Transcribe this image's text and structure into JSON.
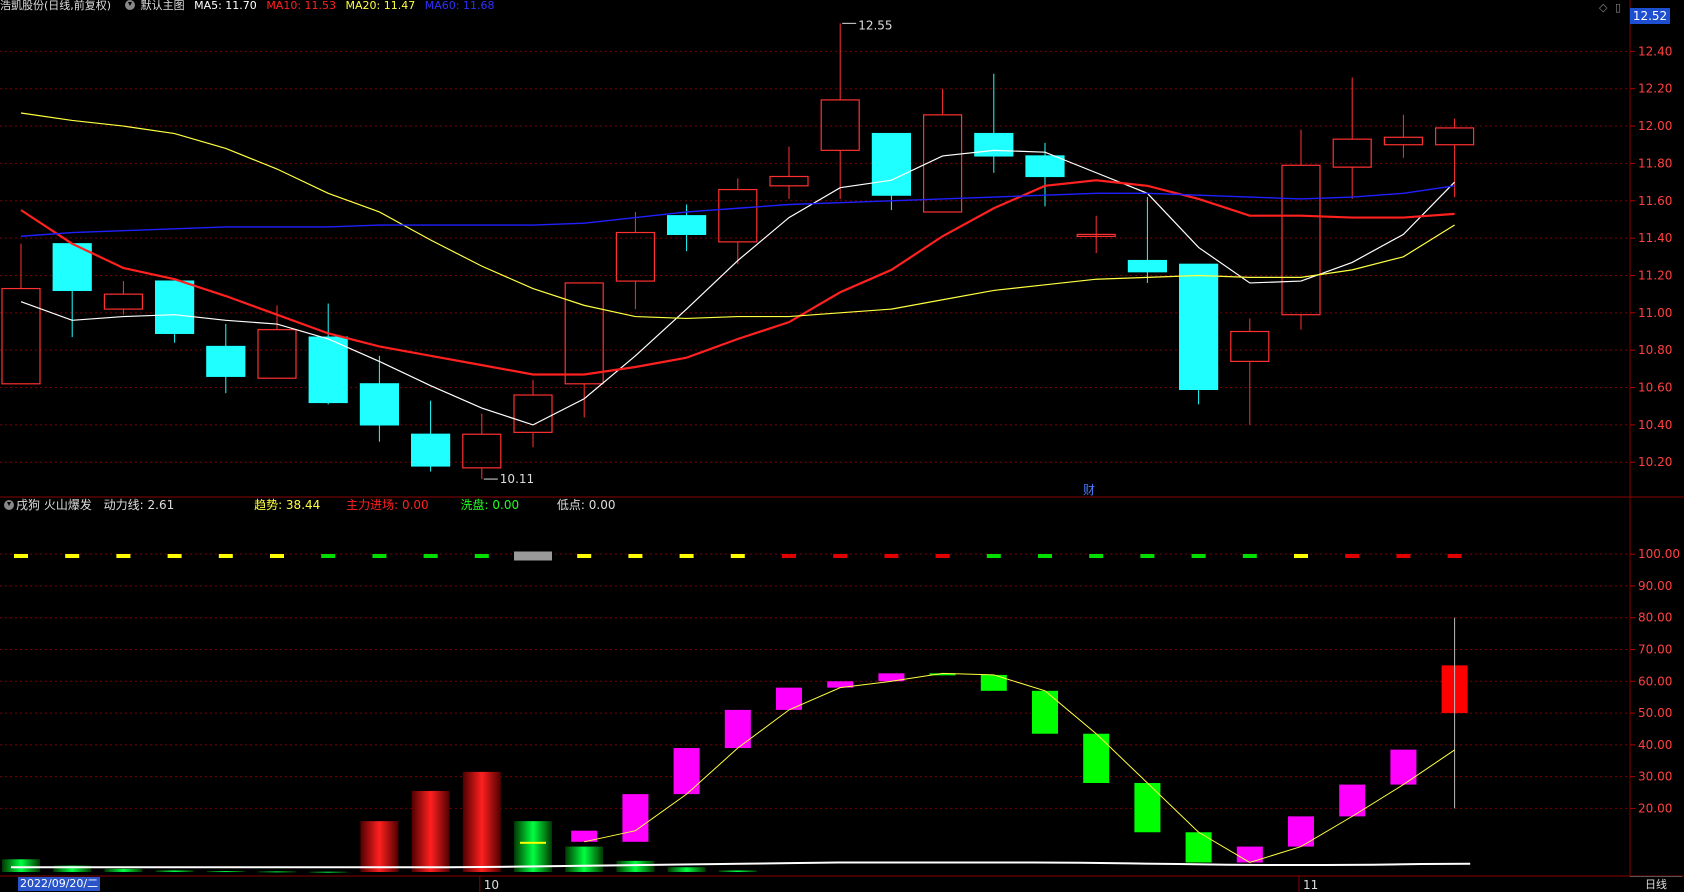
{
  "header": {
    "stock": "浩凱股份",
    "period": "(日线,前复权)",
    "template": "默认主图",
    "ma": [
      {
        "label": "MA5: 11.70",
        "color": "#ffffff"
      },
      {
        "label": "MA10: 11.53",
        "color": "#ff2020"
      },
      {
        "label": "MA20: 11.47",
        "color": "#ffff40"
      },
      {
        "label": "MA60: 11.68",
        "color": "#3030ff"
      }
    ]
  },
  "price_badge": "12.52",
  "indicator_header": {
    "name": "戌狗 火山爆发",
    "fields": [
      {
        "label": "动力线: 2.61",
        "color": "#dddddd"
      },
      {
        "label": "趋势: 38.44",
        "color": "#ffff40"
      },
      {
        "label": "主力进场: 0.00",
        "color": "#ff2020"
      },
      {
        "label": "洗盘: 0.00",
        "color": "#20ff20"
      },
      {
        "label": "低点: 0.00",
        "color": "#dddddd"
      }
    ]
  },
  "cai_label": "财",
  "date_label": "2022/09/20/二",
  "period_tab": "日线",
  "month_labels": [
    "10",
    "11"
  ],
  "colors": {
    "up": "#ff3030",
    "down": "#20ffff",
    "ma5": "#ffffff",
    "ma10": "#ff2020",
    "ma20": "#ffff40",
    "ma60": "#2020ff",
    "grid": "#7a0000",
    "bg": "#000000"
  },
  "chart_data": [
    {
      "type": "candlestick",
      "title": "",
      "y_ticks": [
        10.2,
        10.4,
        10.6,
        10.8,
        11.0,
        11.2,
        11.4,
        11.6,
        11.8,
        12.0,
        12.2,
        12.4
      ],
      "ylim": [
        10.03,
        12.6
      ],
      "annotations": [
        {
          "text": "12.55",
          "index": 16,
          "value": 12.55
        },
        {
          "text": "10.11",
          "index": 9,
          "value": 10.11
        }
      ],
      "candles": [
        {
          "o": 10.62,
          "h": 11.37,
          "l": 10.62,
          "c": 11.13
        },
        {
          "o": 11.37,
          "h": 11.37,
          "l": 10.87,
          "c": 11.12
        },
        {
          "o": 11.02,
          "h": 11.17,
          "l": 10.99,
          "c": 11.1
        },
        {
          "o": 11.17,
          "h": 11.17,
          "l": 10.84,
          "c": 10.89
        },
        {
          "o": 10.82,
          "h": 10.94,
          "l": 10.57,
          "c": 10.66
        },
        {
          "o": 10.65,
          "h": 11.04,
          "l": 10.65,
          "c": 10.91
        },
        {
          "o": 10.87,
          "h": 11.05,
          "l": 10.51,
          "c": 10.52
        },
        {
          "o": 10.62,
          "h": 10.77,
          "l": 10.31,
          "c": 10.4
        },
        {
          "o": 10.35,
          "h": 10.53,
          "l": 10.15,
          "c": 10.18
        },
        {
          "o": 10.17,
          "h": 10.46,
          "l": 10.11,
          "c": 10.35
        },
        {
          "o": 10.36,
          "h": 10.64,
          "l": 10.28,
          "c": 10.56
        },
        {
          "o": 10.62,
          "h": 11.16,
          "l": 10.44,
          "c": 11.16
        },
        {
          "o": 11.17,
          "h": 11.54,
          "l": 11.02,
          "c": 11.43
        },
        {
          "o": 11.52,
          "h": 11.58,
          "l": 11.33,
          "c": 11.42
        },
        {
          "o": 11.38,
          "h": 11.72,
          "l": 11.26,
          "c": 11.66
        },
        {
          "o": 11.68,
          "h": 11.89,
          "l": 11.61,
          "c": 11.73
        },
        {
          "o": 11.87,
          "h": 12.55,
          "l": 11.61,
          "c": 12.14
        },
        {
          "o": 11.96,
          "h": 11.96,
          "l": 11.55,
          "c": 11.63
        },
        {
          "o": 11.54,
          "h": 12.2,
          "l": 11.54,
          "c": 12.06
        },
        {
          "o": 11.96,
          "h": 12.28,
          "l": 11.75,
          "c": 11.84
        },
        {
          "o": 11.84,
          "h": 11.91,
          "l": 11.57,
          "c": 11.73
        },
        {
          "o": 11.42,
          "h": 11.52,
          "l": 11.32,
          "c": 11.42
        },
        {
          "o": 11.28,
          "h": 11.62,
          "l": 11.16,
          "c": 11.22
        },
        {
          "o": 11.26,
          "h": 11.26,
          "l": 10.51,
          "c": 10.59
        },
        {
          "o": 10.74,
          "h": 10.97,
          "l": 10.4,
          "c": 10.9
        },
        {
          "o": 10.99,
          "h": 11.98,
          "l": 10.91,
          "c": 11.79
        },
        {
          "o": 11.78,
          "h": 12.26,
          "l": 11.61,
          "c": 11.93
        },
        {
          "o": 11.9,
          "h": 12.06,
          "l": 11.83,
          "c": 11.94
        },
        {
          "o": 11.9,
          "h": 12.04,
          "l": 11.62,
          "c": 11.99
        }
      ],
      "series": [
        {
          "name": "MA5",
          "values": [
            11.06,
            10.96,
            10.98,
            10.99,
            10.96,
            10.94,
            10.86,
            10.74,
            10.61,
            10.49,
            10.4,
            10.54,
            10.77,
            11.02,
            11.28,
            11.51,
            11.67,
            11.71,
            11.84,
            11.87,
            11.86,
            11.75,
            11.64,
            11.35,
            11.16,
            11.17,
            11.27,
            11.42,
            11.7
          ]
        },
        {
          "name": "MA10",
          "values": [
            11.55,
            11.37,
            11.24,
            11.18,
            11.09,
            10.99,
            10.89,
            10.82,
            10.77,
            10.72,
            10.67,
            10.67,
            10.71,
            10.76,
            10.86,
            10.95,
            11.11,
            11.23,
            11.41,
            11.56,
            11.68,
            11.71,
            11.68,
            11.61,
            11.52,
            11.52,
            11.51,
            11.51,
            11.53
          ]
        },
        {
          "name": "MA20",
          "values": [
            12.07,
            12.03,
            12.0,
            11.96,
            11.88,
            11.77,
            11.64,
            11.54,
            11.39,
            11.25,
            11.13,
            11.04,
            10.98,
            10.97,
            10.98,
            10.98,
            11.0,
            11.02,
            11.07,
            11.12,
            11.15,
            11.18,
            11.19,
            11.2,
            11.19,
            11.19,
            11.23,
            11.3,
            11.47
          ]
        },
        {
          "name": "MA60",
          "values": [
            11.41,
            11.43,
            11.44,
            11.45,
            11.46,
            11.46,
            11.46,
            11.47,
            11.47,
            11.47,
            11.47,
            11.48,
            11.51,
            11.54,
            11.56,
            11.58,
            11.59,
            11.6,
            11.61,
            11.62,
            11.63,
            11.64,
            11.64,
            11.63,
            11.62,
            11.61,
            11.62,
            11.64,
            11.68
          ]
        }
      ]
    },
    {
      "type": "bar",
      "title": "戌狗 火山爆发",
      "y_ticks": [
        20,
        30,
        40,
        50,
        60,
        70,
        80,
        90,
        100
      ],
      "ylim": [
        0,
        112
      ],
      "signal_colors": [
        "yellow",
        "yellow",
        "yellow",
        "yellow",
        "yellow",
        "yellow",
        "green",
        "green",
        "green",
        "green",
        "gray",
        "yellow",
        "yellow",
        "yellow",
        "yellow",
        "red",
        "red",
        "red",
        "red",
        "green",
        "green",
        "green",
        "green",
        "green",
        "green",
        "yellow",
        "red",
        "red",
        "red"
      ],
      "vol_bars": [
        {
          "from": 0,
          "to": 4,
          "color": "green"
        },
        {
          "from": 0,
          "to": 2,
          "color": "green"
        },
        {
          "from": 0,
          "to": 1,
          "color": "green"
        },
        {
          "from": 0,
          "to": 0.5,
          "color": "green"
        },
        {
          "from": 0,
          "to": 0.3,
          "color": "green"
        },
        {
          "from": 0,
          "to": 0.2,
          "color": "green"
        },
        {
          "from": 0,
          "to": 0.1,
          "color": "green"
        },
        {
          "from": 0,
          "to": 16,
          "color": "red"
        },
        {
          "from": 0,
          "to": 25.5,
          "color": "red"
        },
        {
          "from": 0,
          "to": 31.5,
          "color": "red"
        },
        {
          "from": 0,
          "to": 16,
          "color": "green"
        },
        {
          "from": 0,
          "to": 8,
          "color": "green"
        },
        {
          "from": 0,
          "to": 3.5,
          "color": "green"
        },
        {
          "from": 0,
          "to": 1.5,
          "color": "green"
        },
        {
          "from": 0,
          "to": 0.5,
          "color": "green"
        }
      ],
      "trend_bars": [
        {
          "from": 9.5,
          "to": 9.5,
          "color": "yellow"
        },
        {
          "from": 9.5,
          "to": 13,
          "color": "magenta"
        },
        {
          "from": 9.5,
          "to": 24.5,
          "color": "magenta"
        },
        {
          "from": 24.5,
          "to": 39,
          "color": "magenta"
        },
        {
          "from": 39,
          "to": 51,
          "color": "magenta"
        },
        {
          "from": 51,
          "to": 58,
          "color": "magenta"
        },
        {
          "from": 58,
          "to": 60,
          "color": "magenta"
        },
        {
          "from": 60,
          "to": 62.5,
          "color": "magenta"
        },
        {
          "from": 62.5,
          "to": 62,
          "color": "green"
        },
        {
          "from": 62,
          "to": 57,
          "color": "green"
        },
        {
          "from": 57,
          "to": 43.5,
          "color": "green"
        },
        {
          "from": 43.5,
          "to": 28,
          "color": "green"
        },
        {
          "from": 28,
          "to": 12.5,
          "color": "green"
        },
        {
          "from": 12.5,
          "to": 3,
          "color": "green"
        },
        {
          "from": 3,
          "to": 8,
          "color": "magenta"
        },
        {
          "from": 8,
          "to": 17.5,
          "color": "magenta"
        },
        {
          "from": 17.5,
          "to": 27.5,
          "color": "magenta"
        },
        {
          "from": 27.5,
          "to": 38.5,
          "color": "magenta"
        },
        {
          "from": 50,
          "to": 65,
          "color": "red"
        }
      ],
      "trend_line": [
        9.5,
        13,
        24.5,
        39,
        51,
        58,
        60,
        62.5,
        62,
        57,
        43.5,
        28,
        12.5,
        3,
        8,
        17.5,
        27.5,
        38.4
      ],
      "power_line": [
        1.5,
        1.5,
        1.5,
        1.5,
        1.5,
        1.5,
        1.5,
        1.5,
        1.5,
        1.5,
        1.6,
        1.8,
        2,
        2.2,
        2.4,
        2.6,
        2.8,
        3,
        3,
        3,
        3,
        3,
        2.9,
        2.7,
        2.5,
        2.3,
        2.2,
        2.2,
        2.3,
        2.5,
        2.6
      ],
      "last_wick": [
        20,
        80
      ]
    }
  ]
}
